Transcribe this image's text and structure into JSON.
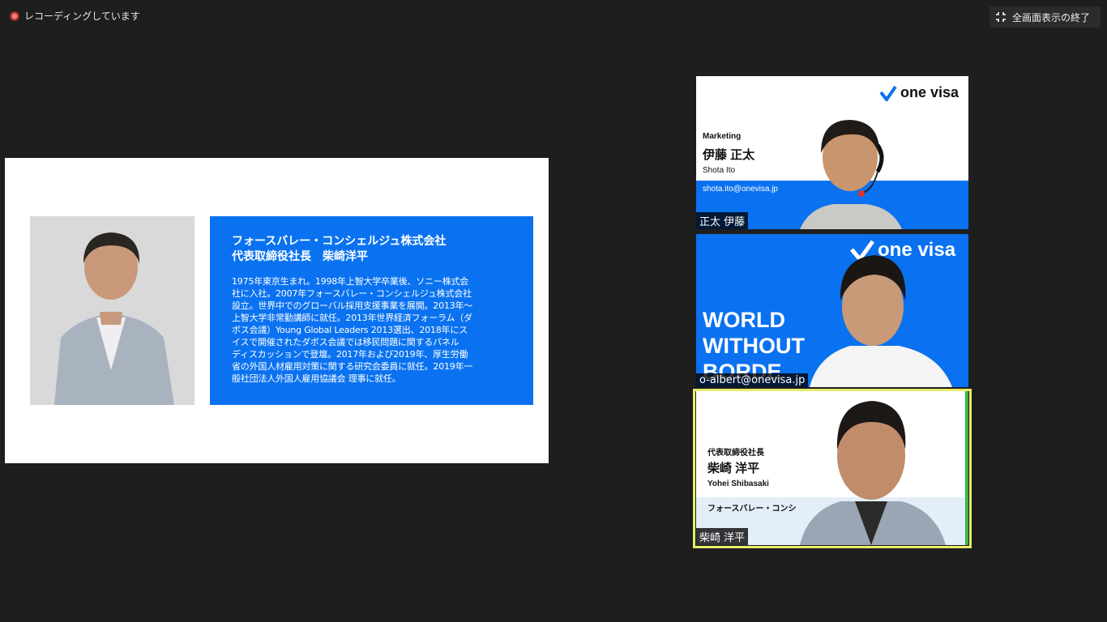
{
  "recording": {
    "label": "レコーディングしています"
  },
  "toolbar": {
    "exit_fullscreen_label": "全画面表示の終了"
  },
  "slide": {
    "title_line1": "フォースバレー・コンシェルジュ株式会社",
    "title_line2": "代表取締役社長　柴崎洋平",
    "bio": [
      "1975年東京生まれ。1998年上智大学卒業後、ソニー株式会",
      "社に入社。2007年フォースバレー・コンシェルジュ株式会社",
      "設立。世界中でのグローバル採用支援事業を展開。2013年〜",
      "上智大学非常勤講師に就任。2013年世界経済フォーラム（ダ",
      "ボス会議）Young Global Leaders 2013選出、2018年にス",
      "イスで開催されたダボス会議では移民問題に関するパネル",
      "ディスカッションで登壇。2017年および2019年、厚生労働",
      "省の外国人材雇用対策に関する研究会委員に就任。2019年一",
      "般社団法人外国人雇用協議会 理事に就任。"
    ]
  },
  "participants": [
    {
      "name": "正太 伊藤",
      "logo": "one visa",
      "role": "Marketing",
      "display_name": "伊藤 正太",
      "roman_name": "Shota Ito",
      "email": "shota.ito@onevisa.jp"
    },
    {
      "name": "o-albert@onevisa.jp",
      "logo": "one visa",
      "slogan_line1": "WORLD",
      "slogan_line2": "WITHOUT",
      "slogan_line3": "BORDE"
    },
    {
      "name": "柴崎 洋平",
      "role": "代表取締役社長",
      "display_name": "柴崎 洋平",
      "roman_name": "Yohei Shibasaki",
      "company": "フォースバレー・コンシ"
    }
  ],
  "colors": {
    "brand_blue": "#0a72f0",
    "active_speaker": "#e8ec6a",
    "background": "#1e1e1e"
  }
}
